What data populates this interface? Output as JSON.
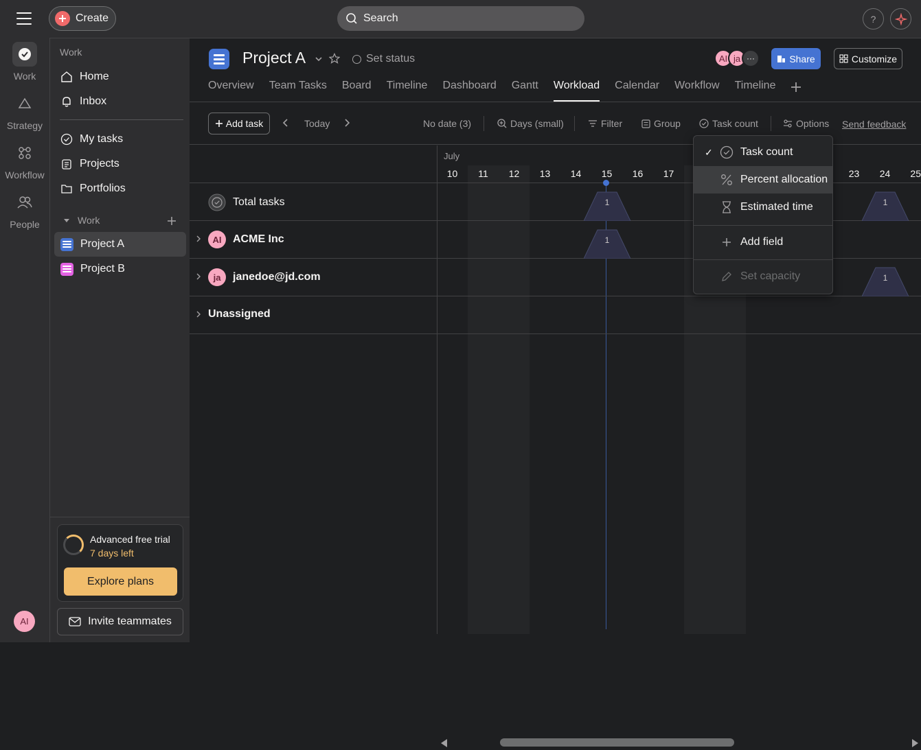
{
  "topbar": {
    "create_label": "Create",
    "search_placeholder": "Search",
    "help_label": "?"
  },
  "rail": {
    "items": [
      {
        "label": "Work",
        "icon": "check-circle-icon"
      },
      {
        "label": "Strategy",
        "icon": "triangle-icon"
      },
      {
        "label": "Workflow",
        "icon": "workflow-icon"
      },
      {
        "label": "People",
        "icon": "people-icon"
      }
    ],
    "user_initials": "AI"
  },
  "sidebar": {
    "work_heading": "Work",
    "home": "Home",
    "inbox": "Inbox",
    "my_tasks": "My tasks",
    "projects": "Projects",
    "portfolios": "Portfolios",
    "section_work": "Work",
    "project_a": "Project A",
    "project_b": "Project B",
    "trial_title": "Advanced free trial",
    "trial_days": "7 days left",
    "explore_label": "Explore plans",
    "invite_label": "Invite teammates"
  },
  "project": {
    "title": "Project A",
    "set_status": "Set status",
    "members": [
      "AI",
      "ja"
    ],
    "share_label": "Share",
    "customize_label": "Customize",
    "tabs": [
      "Overview",
      "Team Tasks",
      "Board",
      "Timeline",
      "Dashboard",
      "Gantt",
      "Workload",
      "Calendar",
      "Workflow",
      "Timeline"
    ],
    "active_tab": "Workload"
  },
  "toolbar": {
    "add_task": "Add task",
    "today": "Today",
    "no_date": "No date (3)",
    "days_small": "Days (small)",
    "filter": "Filter",
    "group": "Group",
    "task_count": "Task count",
    "options": "Options",
    "send_feedback": "Send feedback"
  },
  "timeline": {
    "month": "July",
    "days": [
      "10",
      "11",
      "12",
      "13",
      "14",
      "15",
      "16",
      "17",
      "23",
      "24",
      "25"
    ]
  },
  "rows": [
    {
      "label": "Total tasks",
      "type": "total"
    },
    {
      "label": "ACME Inc",
      "initials": "AI"
    },
    {
      "label": "janedoe@jd.com",
      "initials": "ja"
    },
    {
      "label": "Unassigned"
    }
  ],
  "workload_bumps": [
    {
      "row": "Total tasks",
      "day": "15",
      "count": "1"
    },
    {
      "row": "Total tasks",
      "day": "24",
      "count": "1"
    },
    {
      "row": "ACME Inc",
      "day": "15",
      "count": "1"
    },
    {
      "row": "janedoe@jd.com",
      "day": "24",
      "count": "1"
    }
  ],
  "menu": {
    "task_count": "Task count",
    "percent_allocation": "Percent allocation",
    "estimated_time": "Estimated time",
    "add_field": "Add field",
    "set_capacity": "Set capacity"
  },
  "colors": {
    "accent_blue": "#4573d2",
    "create_red": "#f06a6a",
    "trial_yellow": "#f1bd6c",
    "avatar_pink": "#f8a8c0"
  }
}
